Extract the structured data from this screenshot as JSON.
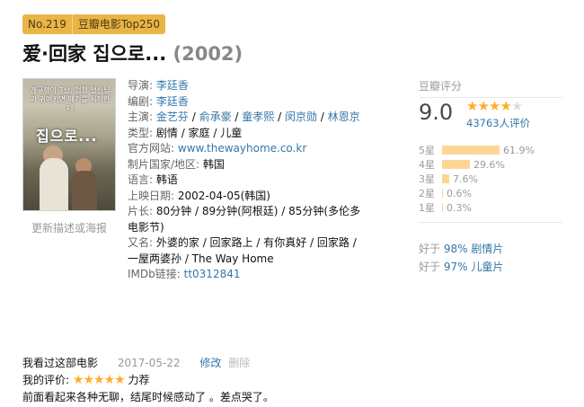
{
  "badge": {
    "rank": "No.219",
    "list": "豆瓣电影Top250"
  },
  "title": {
    "name": "爱·回家 집으로...",
    "year": "(2002)"
  },
  "poster": {
    "overlay_text": "개구쟁이 7살, 엄청 얼신님과 귀여키면 얘기를 시작한다",
    "overlay_title": "집으로..."
  },
  "update_link": "更新描述或海报",
  "info": {
    "director_label": "导演:",
    "director": "李廷香",
    "writer_label": "编剧:",
    "writer": "李廷香",
    "cast_label": "主演:",
    "cast": [
      "金艺芬",
      "俞承豪",
      "童孝熙",
      "闵京勋",
      "林恩京"
    ],
    "genre_label": "类型:",
    "genre": "剧情 / 家庭 / 儿童",
    "site_label": "官方网站:",
    "site": "www.thewayhome.co.kr",
    "country_label": "制片国家/地区:",
    "country": "韩国",
    "language_label": "语言:",
    "language": "韩语",
    "release_label": "上映日期:",
    "release": "2002-04-05(韩国)",
    "runtime_label": "片长:",
    "runtime": "80分钟 / 89分钟(阿根廷) / 85分钟(多伦多电影节)",
    "aka_label": "又名:",
    "aka": "外婆的家 / 回家路上 / 有你真好 / 回家路 / 一屋两婆孙 / The Way Home",
    "imdb_label": "IMDb链接:",
    "imdb": "tt0312841"
  },
  "rating": {
    "title": "豆瓣评分",
    "score": "9.0",
    "stars_value": 4.5,
    "count": "43763人评价",
    "distribution": [
      {
        "label": "5星",
        "percent": "61.9%",
        "value": 61.9
      },
      {
        "label": "4星",
        "percent": "29.6%",
        "value": 29.6
      },
      {
        "label": "3星",
        "percent": "7.6%",
        "value": 7.6
      },
      {
        "label": "2星",
        "percent": "0.6%",
        "value": 0.6
      },
      {
        "label": "1星",
        "percent": "0.3%",
        "value": 0.3
      }
    ],
    "better_than": [
      {
        "prefix": "好于",
        "value": "98% 剧情片"
      },
      {
        "prefix": "好于",
        "value": "97% 儿童片"
      }
    ]
  },
  "my_review": {
    "watched": "我看过这部电影",
    "date": "2017-05-22",
    "edit": "修改",
    "delete": "删除",
    "my_rating_label": "我的评价:",
    "my_stars": 5,
    "my_rating_word": "力荐",
    "comment": "前面看起来各种无聊，结尾时候感动了 。差点哭了。"
  }
}
